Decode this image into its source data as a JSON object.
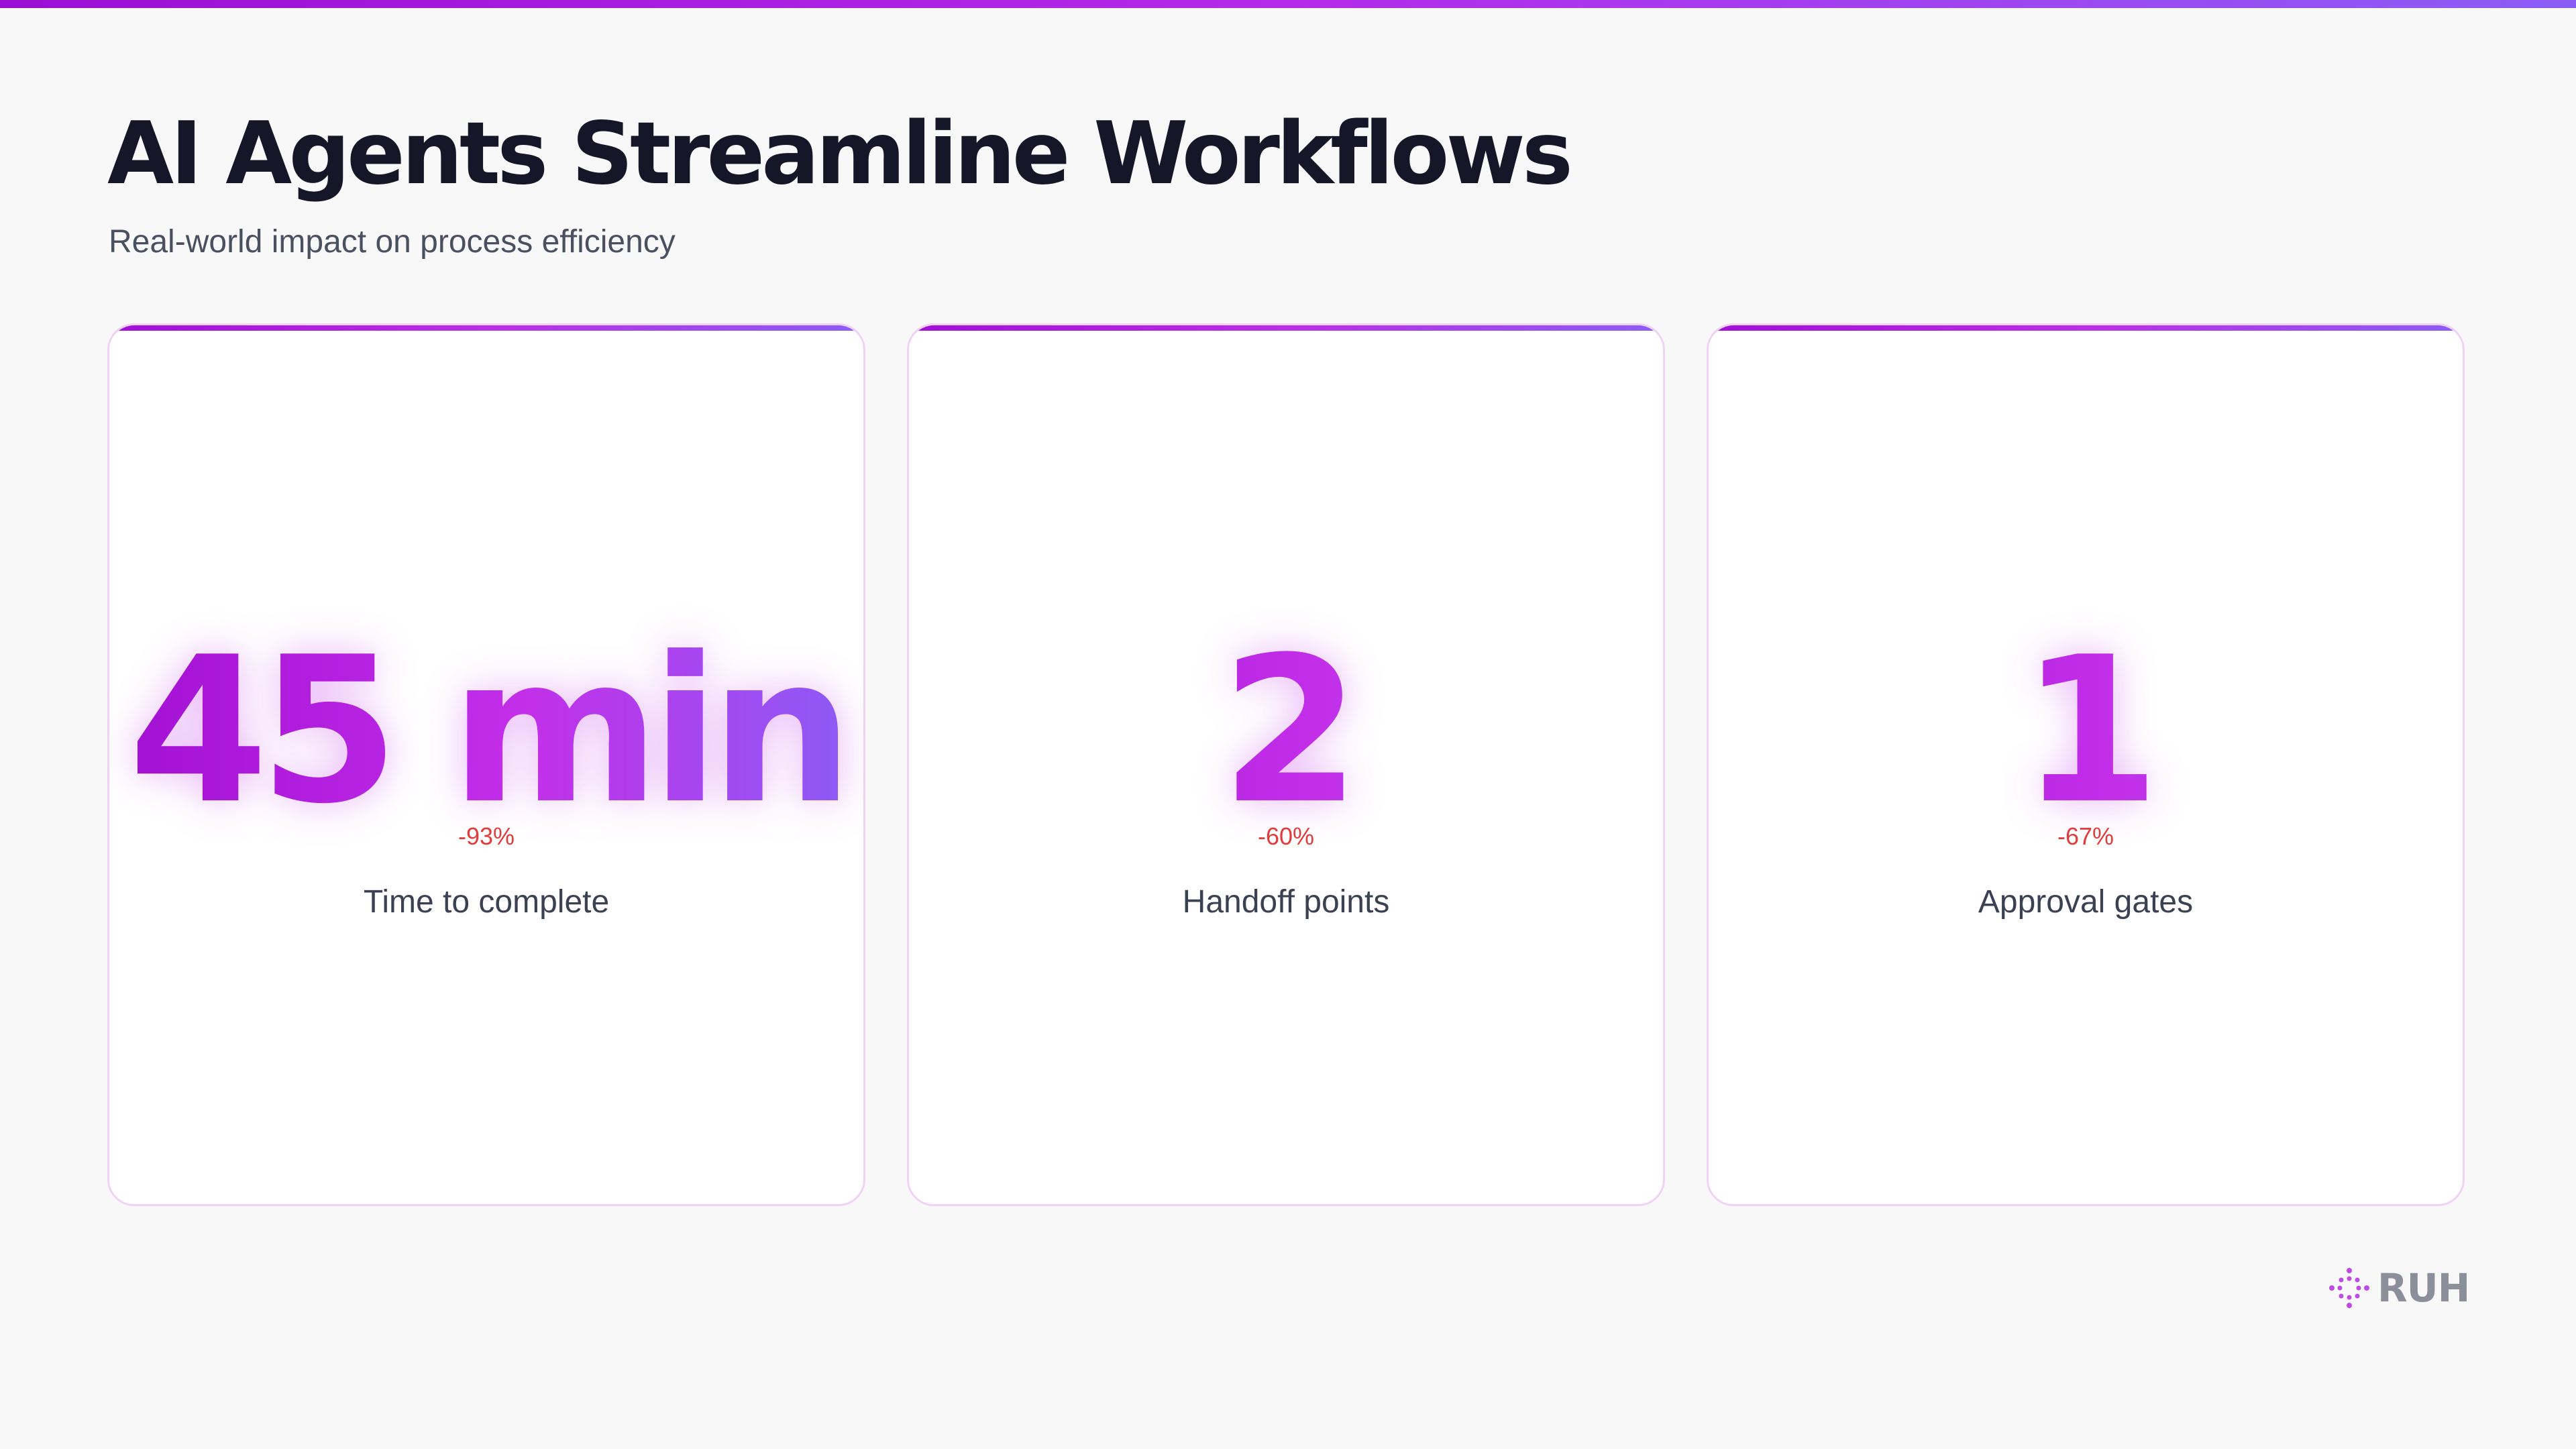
{
  "header": {
    "title": "AI Agents Streamline Workflows",
    "subtitle": "Real-world impact on process efficiency"
  },
  "metrics": [
    {
      "value": "45 min",
      "change": "-93%",
      "label": "Time to complete"
    },
    {
      "value": "2",
      "change": "-60%",
      "label": "Handoff points"
    },
    {
      "value": "1",
      "change": "-67%",
      "label": "Approval gates"
    }
  ],
  "brand": {
    "name": "RUH",
    "icon": "dotted-sparkle-icon"
  },
  "colors": {
    "accent_start": "#a10fd3",
    "accent_mid": "#c32fe9",
    "accent_end": "#8b5cf6",
    "change_negative": "#e23b3b",
    "title": "#161629",
    "background": "#f8f8f9"
  }
}
